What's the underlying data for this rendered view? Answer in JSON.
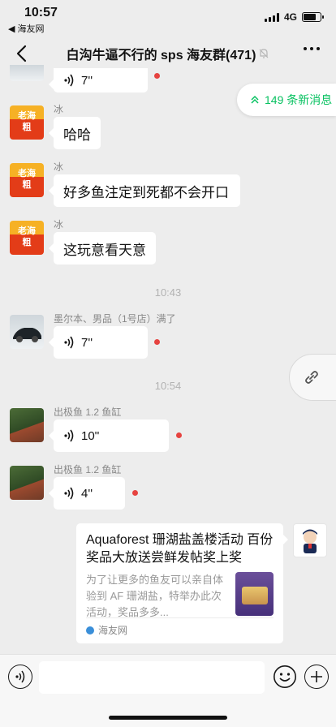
{
  "status_bar": {
    "time": "10:57",
    "back_app": "◀ 海友网",
    "network": "4G"
  },
  "nav": {
    "title": "白沟牛逼不行的 sps 海友群(471)",
    "back_icon": "chevron-left-icon",
    "mute_icon": "bell-off-icon",
    "more_icon": "ellipsis-icon"
  },
  "new_messages": {
    "label": "149 条新消息",
    "icon": "double-chevron-up-icon"
  },
  "accent": {
    "green": "#07c160",
    "unread_red": "#e64340"
  },
  "messages": [
    {
      "type": "voice",
      "duration": "7''",
      "unread": true
    },
    {
      "type": "text",
      "sender": "冰",
      "text": "哈哈",
      "avatar_text": "老海\n粗"
    },
    {
      "type": "text",
      "sender": "冰",
      "text": "好多鱼注定到死都不会开口",
      "avatar_text": "老海\n粗"
    },
    {
      "type": "text",
      "sender": "冰",
      "text": "这玩意看天意",
      "avatar_text": "老海\n粗"
    },
    {
      "type": "time",
      "text": "10:43"
    },
    {
      "type": "voice",
      "sender": "墨尔本、男品（1号店）满了",
      "duration": "7''",
      "unread": true
    },
    {
      "type": "time",
      "text": "10:54"
    },
    {
      "type": "voice",
      "sender": "出极鱼 1.2 鱼缸",
      "duration": "10''",
      "unread": true
    },
    {
      "type": "voice",
      "sender": "出极鱼 1.2 鱼缸",
      "duration": "4''",
      "unread": true
    }
  ],
  "share_card": {
    "title": "Aquaforest 珊湖盐盖楼活动 百份奖品大放送尝鲜发帖奖上奖",
    "description": "为了让更多的鱼友可以亲自体验到 AF 珊湖盐，特举办此次活动，奖品多多...",
    "source": "海友网"
  },
  "input_bar": {
    "voice_icon": "voice-icon",
    "emoji_icon": "emoji-icon",
    "plus_icon": "plus-icon"
  }
}
